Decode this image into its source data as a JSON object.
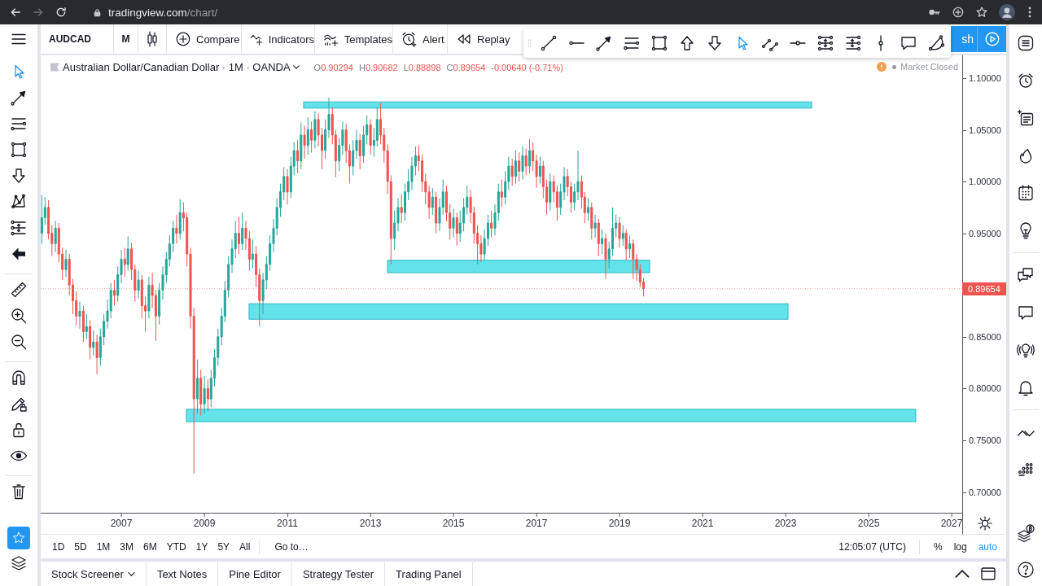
{
  "browser": {
    "nav": [
      {
        "kind": "back",
        "disabled": false
      },
      {
        "kind": "forward",
        "disabled": true
      },
      {
        "kind": "reload",
        "disabled": false
      }
    ],
    "url_host": "tradingview.com",
    "url_path": "/chart/"
  },
  "top_toolbar": {
    "symbol": "AUDCAD",
    "interval": "M",
    "buttons": [
      {
        "kind": "compare",
        "label": "Compare"
      },
      {
        "kind": "indicators",
        "label": "Indicators"
      },
      {
        "kind": "templates",
        "label": "Templates"
      },
      {
        "kind": "alert",
        "label": "Alert"
      },
      {
        "kind": "replay",
        "label": "Replay"
      }
    ],
    "cut_button_label": "sh"
  },
  "drawing_toolbar": {
    "tools": [
      {
        "kind": "line-segment",
        "selected": false
      },
      {
        "kind": "ray",
        "selected": false
      },
      {
        "kind": "arrow-line",
        "selected": false
      },
      {
        "kind": "lines",
        "selected": false
      },
      {
        "kind": "rectangle",
        "selected": false
      },
      {
        "kind": "up-arrow",
        "selected": false
      },
      {
        "kind": "down-arrow",
        "selected": false
      },
      {
        "kind": "cursor",
        "selected": true
      },
      {
        "kind": "parallel-lines",
        "selected": false
      },
      {
        "kind": "horizontal-line",
        "selected": false
      },
      {
        "kind": "level-lines",
        "selected": false
      },
      {
        "kind": "extension-lines",
        "selected": false
      },
      {
        "kind": "vertical-line",
        "selected": false
      },
      {
        "kind": "speech-bubble",
        "selected": false
      },
      {
        "kind": "curve",
        "selected": false
      }
    ]
  },
  "left_toolbar": {
    "groups": [
      {
        "tools": [
          {
            "kind": "cursor",
            "selected": true
          },
          {
            "kind": "arrow-line",
            "selected": false
          },
          {
            "kind": "lines",
            "selected": false
          },
          {
            "kind": "rectangle",
            "selected": false
          },
          {
            "kind": "down-arrow",
            "selected": false
          },
          {
            "kind": "pattern",
            "selected": false
          },
          {
            "kind": "channel",
            "selected": false
          },
          {
            "kind": "back-arrow",
            "selected": false
          }
        ]
      },
      {
        "tools": [
          {
            "kind": "ruler",
            "selected": false
          },
          {
            "kind": "zoom-in",
            "selected": false
          },
          {
            "kind": "zoom-out",
            "selected": false
          }
        ]
      },
      {
        "tools": [
          {
            "kind": "magnet",
            "selected": false
          },
          {
            "kind": "pencil-lock",
            "selected": false
          },
          {
            "kind": "lock",
            "selected": false
          },
          {
            "kind": "eye",
            "selected": false
          }
        ]
      },
      {
        "tools": [
          {
            "kind": "trash",
            "selected": false
          }
        ]
      },
      {
        "tools": [
          {
            "kind": "star",
            "selected": true
          },
          {
            "kind": "layers",
            "selected": false
          }
        ]
      }
    ]
  },
  "chart": {
    "legend": {
      "title": "Australian Dollar/Canadian Dollar · 1M · OANDA",
      "ohlc": [
        {
          "label": "O",
          "value": "0.90294"
        },
        {
          "label": "H",
          "value": "0.90682"
        },
        {
          "label": "L",
          "value": "0.88898"
        },
        {
          "label": "C",
          "value": "0.89654"
        }
      ],
      "change": "-0.00640 (-0.71%)",
      "market_status": "Market Closed"
    },
    "chart_data": [
      {
        "type": "candlestick",
        "xlim": [
          "2005-01-22",
          "2027-04-04"
        ],
        "ylim": [
          0.68,
          1.122
        ],
        "xticks": [
          {
            "value": "2007-01-01",
            "label": "2007"
          },
          {
            "value": "2009-01-01",
            "label": "2009"
          },
          {
            "value": "2011-01-01",
            "label": "2011"
          },
          {
            "value": "2013-01-01",
            "label": "2013"
          },
          {
            "value": "2015-01-01",
            "label": "2015"
          },
          {
            "value": "2017-01-01",
            "label": "2017"
          },
          {
            "value": "2019-01-01",
            "label": "2019"
          },
          {
            "value": "2021-01-01",
            "label": "2021"
          },
          {
            "value": "2023-01-01",
            "label": "2023"
          },
          {
            "value": "2025-01-01",
            "label": "2025"
          },
          {
            "value": "2027-01-01",
            "label": "2027"
          }
        ],
        "yticks": [
          {
            "value": 1.1,
            "label": "1.10000"
          },
          {
            "value": 1.05,
            "label": "1.05000"
          },
          {
            "value": 1.0,
            "label": "1.00000"
          },
          {
            "value": 0.95,
            "label": "0.95000"
          },
          {
            "value": 0.85,
            "label": "0.85000"
          },
          {
            "value": 0.8,
            "label": "0.80000"
          },
          {
            "value": 0.75,
            "label": "0.75000"
          },
          {
            "value": 0.7,
            "label": "0.70000"
          }
        ],
        "ref_lines": [
          {
            "axis": "y",
            "value": 0.89654,
            "label": "0.89654",
            "color": "#ef5350",
            "line_style": "dotted"
          }
        ],
        "bands": [
          {
            "axis": "y",
            "from": 1.071,
            "to": 1.077,
            "color": "#63e2ea"
          },
          {
            "axis": "y",
            "from": 0.912,
            "to": 0.924,
            "color": "#63e2ea"
          },
          {
            "axis": "y",
            "from": 0.867,
            "to": 0.882,
            "color": "#63e2ea"
          },
          {
            "axis": "y",
            "from": 0.768,
            "to": 0.78,
            "color": "#63e2ea"
          }
        ],
        "x": [
          "2005-02-01",
          "2005-03-01",
          "2005-04-01",
          "2005-05-01",
          "2005-06-01",
          "2005-07-01",
          "2005-08-01",
          "2005-09-01",
          "2005-10-01",
          "2005-11-01",
          "2005-12-01",
          "2006-01-01",
          "2006-02-01",
          "2006-03-01",
          "2006-04-01",
          "2006-05-01",
          "2006-06-01",
          "2006-07-01",
          "2006-08-01",
          "2006-09-01",
          "2006-10-01",
          "2006-11-01",
          "2006-12-01",
          "2007-01-01",
          "2007-02-01",
          "2007-03-01",
          "2007-04-01",
          "2007-05-01",
          "2007-06-01",
          "2007-07-01",
          "2007-08-01",
          "2007-09-01",
          "2007-10-01",
          "2007-11-01",
          "2007-12-01",
          "2008-01-01",
          "2008-02-01",
          "2008-03-01",
          "2008-04-01",
          "2008-05-01",
          "2008-06-01",
          "2008-07-01",
          "2008-08-01",
          "2008-09-01",
          "2008-10-01",
          "2008-11-01",
          "2008-12-01",
          "2009-01-01",
          "2009-02-01",
          "2009-03-01",
          "2009-04-01",
          "2009-05-01",
          "2009-06-01",
          "2009-07-01",
          "2009-08-01",
          "2009-09-01",
          "2009-10-01",
          "2009-11-01",
          "2009-12-01",
          "2010-01-01",
          "2010-02-01",
          "2010-03-01",
          "2010-04-01",
          "2010-05-01",
          "2010-06-01",
          "2010-07-01",
          "2010-08-01",
          "2010-09-01",
          "2010-10-01",
          "2010-11-01",
          "2010-12-01",
          "2011-01-01",
          "2011-02-01",
          "2011-03-01",
          "2011-04-01",
          "2011-05-01",
          "2011-06-01",
          "2011-07-01",
          "2011-08-01",
          "2011-09-01",
          "2011-10-01",
          "2011-11-01",
          "2011-12-01",
          "2012-01-01",
          "2012-02-01",
          "2012-03-01",
          "2012-04-01",
          "2012-05-01",
          "2012-06-01",
          "2012-07-01",
          "2012-08-01",
          "2012-09-01",
          "2012-10-01",
          "2012-11-01",
          "2012-12-01",
          "2013-01-01",
          "2013-02-01",
          "2013-03-01",
          "2013-04-01",
          "2013-05-01",
          "2013-06-01",
          "2013-07-01",
          "2013-08-01",
          "2013-09-01",
          "2013-10-01",
          "2013-11-01",
          "2013-12-01",
          "2014-01-01",
          "2014-02-01",
          "2014-03-01",
          "2014-04-01",
          "2014-05-01",
          "2014-06-01",
          "2014-07-01",
          "2014-08-01",
          "2014-09-01",
          "2014-10-01",
          "2014-11-01",
          "2014-12-01",
          "2015-01-01",
          "2015-02-01",
          "2015-03-01",
          "2015-04-01",
          "2015-05-01",
          "2015-06-01",
          "2015-07-01",
          "2015-08-01",
          "2015-09-01",
          "2015-10-01",
          "2015-11-01",
          "2015-12-01",
          "2016-01-01",
          "2016-02-01",
          "2016-03-01",
          "2016-04-01",
          "2016-05-01",
          "2016-06-01",
          "2016-07-01",
          "2016-08-01",
          "2016-09-01",
          "2016-10-01",
          "2016-11-01",
          "2016-12-01",
          "2017-01-01",
          "2017-02-01",
          "2017-03-01",
          "2017-04-01",
          "2017-05-01",
          "2017-06-01",
          "2017-07-01",
          "2017-08-01",
          "2017-09-01",
          "2017-10-01",
          "2017-11-01",
          "2017-12-01",
          "2018-01-01",
          "2018-02-01",
          "2018-03-01",
          "2018-04-01",
          "2018-05-01",
          "2018-06-01",
          "2018-07-01",
          "2018-08-01",
          "2018-09-01",
          "2018-10-01",
          "2018-11-01",
          "2018-12-01",
          "2019-01-01",
          "2019-02-01",
          "2019-03-01",
          "2019-04-01",
          "2019-05-01",
          "2019-06-01",
          "2019-07-01",
          "2019-08-01"
        ],
        "ohlc": [
          [
            0.95,
            0.987,
            0.94,
            0.965
          ],
          [
            0.965,
            0.985,
            0.958,
            0.975
          ],
          [
            0.975,
            0.982,
            0.944,
            0.95
          ],
          [
            0.95,
            0.958,
            0.928,
            0.94
          ],
          [
            0.94,
            0.962,
            0.932,
            0.955
          ],
          [
            0.955,
            0.96,
            0.922,
            0.93
          ],
          [
            0.93,
            0.936,
            0.905,
            0.915
          ],
          [
            0.915,
            0.934,
            0.908,
            0.925
          ],
          [
            0.925,
            0.93,
            0.89,
            0.9
          ],
          [
            0.9,
            0.906,
            0.872,
            0.885
          ],
          [
            0.885,
            0.894,
            0.861,
            0.87
          ],
          [
            0.87,
            0.884,
            0.858,
            0.875
          ],
          [
            0.875,
            0.88,
            0.845,
            0.855
          ],
          [
            0.855,
            0.872,
            0.848,
            0.86
          ],
          [
            0.86,
            0.866,
            0.828,
            0.84
          ],
          [
            0.84,
            0.856,
            0.832,
            0.845
          ],
          [
            0.845,
            0.852,
            0.814,
            0.83
          ],
          [
            0.83,
            0.858,
            0.822,
            0.85
          ],
          [
            0.85,
            0.872,
            0.842,
            0.865
          ],
          [
            0.865,
            0.886,
            0.858,
            0.875
          ],
          [
            0.875,
            0.902,
            0.868,
            0.895
          ],
          [
            0.895,
            0.905,
            0.88,
            0.89
          ],
          [
            0.89,
            0.918,
            0.884,
            0.91
          ],
          [
            0.91,
            0.934,
            0.902,
            0.925
          ],
          [
            0.925,
            0.936,
            0.908,
            0.92
          ],
          [
            0.92,
            0.947,
            0.914,
            0.935
          ],
          [
            0.935,
            0.941,
            0.905,
            0.915
          ],
          [
            0.915,
            0.92,
            0.884,
            0.895
          ],
          [
            0.895,
            0.914,
            0.887,
            0.905
          ],
          [
            0.905,
            0.91,
            0.868,
            0.88
          ],
          [
            0.88,
            0.889,
            0.855,
            0.875
          ],
          [
            0.875,
            0.908,
            0.868,
            0.9
          ],
          [
            0.9,
            0.912,
            0.878,
            0.89
          ],
          [
            0.89,
            0.895,
            0.846,
            0.87
          ],
          [
            0.87,
            0.902,
            0.862,
            0.895
          ],
          [
            0.895,
            0.918,
            0.886,
            0.91
          ],
          [
            0.91,
            0.932,
            0.902,
            0.925
          ],
          [
            0.925,
            0.948,
            0.918,
            0.94
          ],
          [
            0.94,
            0.962,
            0.932,
            0.955
          ],
          [
            0.955,
            0.968,
            0.94,
            0.95
          ],
          [
            0.95,
            0.983,
            0.944,
            0.97
          ],
          [
            0.97,
            0.98,
            0.952,
            0.965
          ],
          [
            0.965,
            0.97,
            0.918,
            0.93
          ],
          [
            0.93,
            0.936,
            0.858,
            0.87
          ],
          [
            0.87,
            0.878,
            0.718,
            0.79
          ],
          [
            0.79,
            0.828,
            0.776,
            0.81
          ],
          [
            0.81,
            0.818,
            0.774,
            0.785
          ],
          [
            0.785,
            0.812,
            0.776,
            0.8
          ],
          [
            0.8,
            0.809,
            0.778,
            0.79
          ],
          [
            0.79,
            0.818,
            0.782,
            0.81
          ],
          [
            0.81,
            0.838,
            0.802,
            0.83
          ],
          [
            0.83,
            0.858,
            0.822,
            0.85
          ],
          [
            0.85,
            0.878,
            0.842,
            0.87
          ],
          [
            0.87,
            0.904,
            0.864,
            0.895
          ],
          [
            0.895,
            0.928,
            0.888,
            0.92
          ],
          [
            0.92,
            0.944,
            0.912,
            0.935
          ],
          [
            0.935,
            0.962,
            0.926,
            0.95
          ],
          [
            0.95,
            0.966,
            0.93,
            0.94
          ],
          [
            0.94,
            0.97,
            0.934,
            0.955
          ],
          [
            0.955,
            0.962,
            0.934,
            0.945
          ],
          [
            0.945,
            0.952,
            0.914,
            0.925
          ],
          [
            0.925,
            0.944,
            0.916,
            0.93
          ],
          [
            0.93,
            0.938,
            0.898,
            0.91
          ],
          [
            0.91,
            0.916,
            0.86,
            0.885
          ],
          [
            0.885,
            0.912,
            0.872,
            0.905
          ],
          [
            0.905,
            0.928,
            0.896,
            0.92
          ],
          [
            0.92,
            0.948,
            0.914,
            0.94
          ],
          [
            0.94,
            0.964,
            0.932,
            0.955
          ],
          [
            0.955,
            0.984,
            0.948,
            0.975
          ],
          [
            0.975,
            0.998,
            0.966,
            0.99
          ],
          [
            0.99,
            1.014,
            0.982,
            1.005
          ],
          [
            1.005,
            1.012,
            0.978,
            0.99
          ],
          [
            0.99,
            1.024,
            0.984,
            1.015
          ],
          [
            1.015,
            1.038,
            1.006,
            1.03
          ],
          [
            1.03,
            1.04,
            1.008,
            1.02
          ],
          [
            1.02,
            1.057,
            1.012,
            1.045
          ],
          [
            1.045,
            1.054,
            1.022,
            1.035
          ],
          [
            1.035,
            1.062,
            1.026,
            1.05
          ],
          [
            1.05,
            1.058,
            1.028,
            1.04
          ],
          [
            1.04,
            1.068,
            1.032,
            1.06
          ],
          [
            1.06,
            1.066,
            1.034,
            1.045
          ],
          [
            1.045,
            1.052,
            1.012,
            1.03
          ],
          [
            1.03,
            1.06,
            1.022,
            1.05
          ],
          [
            1.05,
            1.081,
            1.042,
            1.065
          ],
          [
            1.065,
            1.072,
            1.036,
            1.045
          ],
          [
            1.045,
            1.05,
            1.004,
            1.02
          ],
          [
            1.02,
            1.042,
            1.01,
            1.035
          ],
          [
            1.035,
            1.058,
            1.026,
            1.05
          ],
          [
            1.05,
            1.056,
            1.018,
            1.03
          ],
          [
            1.03,
            1.036,
            0.998,
            1.015
          ],
          [
            1.015,
            1.04,
            1.006,
            1.03
          ],
          [
            1.03,
            1.05,
            1.022,
            1.04
          ],
          [
            1.04,
            1.046,
            1.012,
            1.025
          ],
          [
            1.025,
            1.054,
            1.018,
            1.045
          ],
          [
            1.045,
            1.064,
            1.036,
            1.055
          ],
          [
            1.055,
            1.06,
            1.026,
            1.035
          ],
          [
            1.035,
            1.052,
            1.024,
            1.04
          ],
          [
            1.04,
            1.072,
            1.034,
            1.06
          ],
          [
            1.06,
            1.076,
            1.036,
            1.045
          ],
          [
            1.045,
            1.052,
            1.018,
            1.03
          ],
          [
            1.03,
            1.036,
            0.988,
            1.0
          ],
          [
            1.0,
            1.006,
            0.92,
            0.945
          ],
          [
            0.945,
            0.972,
            0.934,
            0.96
          ],
          [
            0.96,
            0.984,
            0.952,
            0.975
          ],
          [
            0.975,
            0.988,
            0.96,
            0.97
          ],
          [
            0.97,
            0.998,
            0.962,
            0.99
          ],
          [
            0.99,
            1.012,
            0.982,
            1.0
          ],
          [
            1.0,
            1.024,
            0.992,
            1.015
          ],
          [
            1.015,
            1.034,
            1.006,
            1.025
          ],
          [
            1.025,
            1.035,
            1.01,
            1.02
          ],
          [
            1.02,
            1.026,
            0.99,
            1.0
          ],
          [
            1.0,
            1.008,
            0.978,
            0.99
          ],
          [
            0.99,
            0.996,
            0.964,
            0.975
          ],
          [
            0.975,
            0.994,
            0.968,
            0.985
          ],
          [
            0.985,
            0.99,
            0.95,
            0.96
          ],
          [
            0.96,
            0.984,
            0.952,
            0.975
          ],
          [
            0.975,
            1.002,
            0.968,
            0.99
          ],
          [
            0.99,
            0.996,
            0.962,
            0.97
          ],
          [
            0.97,
            0.978,
            0.944,
            0.955
          ],
          [
            0.955,
            0.974,
            0.946,
            0.965
          ],
          [
            0.965,
            0.97,
            0.938,
            0.95
          ],
          [
            0.95,
            0.972,
            0.942,
            0.96
          ],
          [
            0.96,
            0.984,
            0.952,
            0.975
          ],
          [
            0.975,
            0.996,
            0.968,
            0.985
          ],
          [
            0.985,
            0.992,
            0.96,
            0.97
          ],
          [
            0.97,
            0.976,
            0.94,
            0.95
          ],
          [
            0.95,
            0.958,
            0.92,
            0.94
          ],
          [
            0.94,
            0.948,
            0.922,
            0.93
          ],
          [
            0.93,
            0.954,
            0.924,
            0.945
          ],
          [
            0.945,
            0.968,
            0.938,
            0.96
          ],
          [
            0.96,
            0.972,
            0.946,
            0.955
          ],
          [
            0.955,
            0.978,
            0.948,
            0.97
          ],
          [
            0.97,
            0.998,
            0.962,
            0.99
          ],
          [
            0.99,
            1.002,
            0.976,
            0.985
          ],
          [
            0.985,
            1.01,
            0.978,
            1.0
          ],
          [
            1.0,
            1.024,
            0.992,
            1.015
          ],
          [
            1.015,
            1.022,
            0.996,
            1.005
          ],
          [
            1.005,
            1.03,
            0.998,
            1.02
          ],
          [
            1.02,
            1.028,
            1.0,
            1.01
          ],
          [
            1.01,
            1.034,
            1.002,
            1.025
          ],
          [
            1.025,
            1.032,
            1.006,
            1.015
          ],
          [
            1.015,
            1.041,
            1.008,
            1.03
          ],
          [
            1.03,
            1.038,
            1.01,
            1.02
          ],
          [
            1.02,
            1.026,
            0.994,
            1.005
          ],
          [
            1.005,
            1.024,
            0.998,
            1.015
          ],
          [
            1.015,
            1.02,
            0.984,
            0.995
          ],
          [
            0.995,
            1.002,
            0.968,
            0.98
          ],
          [
            0.98,
            1.008,
            0.972,
            1.0
          ],
          [
            1.0,
            1.006,
            0.98,
            0.99
          ],
          [
            0.99,
            0.996,
            0.962,
            0.975
          ],
          [
            0.975,
            0.998,
            0.968,
            0.99
          ],
          [
            0.99,
            1.014,
            0.982,
            1.005
          ],
          [
            1.005,
            1.012,
            0.986,
            0.995
          ],
          [
            0.995,
            1.0,
            0.97,
            0.98
          ],
          [
            0.98,
            0.998,
            0.972,
            0.99
          ],
          [
            0.99,
            1.03,
            0.982,
            1.0
          ],
          [
            1.0,
            1.006,
            0.974,
            0.985
          ],
          [
            0.985,
            0.99,
            0.96,
            0.97
          ],
          [
            0.97,
            0.984,
            0.962,
            0.975
          ],
          [
            0.975,
            0.98,
            0.944,
            0.955
          ],
          [
            0.955,
            0.968,
            0.946,
            0.96
          ],
          [
            0.96,
            0.964,
            0.928,
            0.94
          ],
          [
            0.94,
            0.954,
            0.93,
            0.945
          ],
          [
            0.945,
            0.95,
            0.906,
            0.925
          ],
          [
            0.925,
            0.942,
            0.916,
            0.935
          ],
          [
            0.935,
            0.975,
            0.928,
            0.955
          ],
          [
            0.955,
            0.968,
            0.946,
            0.96
          ],
          [
            0.96,
            0.966,
            0.936,
            0.945
          ],
          [
            0.945,
            0.958,
            0.938,
            0.95
          ],
          [
            0.95,
            0.954,
            0.924,
            0.935
          ],
          [
            0.935,
            0.948,
            0.926,
            0.94
          ],
          [
            0.94,
            0.944,
            0.906,
            0.925
          ],
          [
            0.925,
            0.93,
            0.904,
            0.915
          ],
          [
            0.915,
            0.92,
            0.898,
            0.90294
          ],
          [
            0.90294,
            0.90682,
            0.88898,
            0.89654
          ]
        ]
      }
    ]
  },
  "range_bar": {
    "ranges": [
      "1D",
      "5D",
      "1M",
      "3M",
      "6M",
      "YTD",
      "1Y",
      "5Y",
      "All"
    ],
    "goto": "Go to…",
    "time": "12:05:07 (UTC)",
    "scale_options": [
      {
        "label": "%",
        "on": false
      },
      {
        "label": "log",
        "on": false
      },
      {
        "label": "auto",
        "on": true
      }
    ]
  },
  "bottom_tabs": [
    {
      "label": "Stock Screener",
      "dropdown": true
    },
    {
      "label": "Text Notes",
      "dropdown": false
    },
    {
      "label": "Pine Editor",
      "dropdown": false
    },
    {
      "label": "Strategy Tester",
      "dropdown": false
    },
    {
      "label": "Trading Panel",
      "dropdown": false
    }
  ]
}
